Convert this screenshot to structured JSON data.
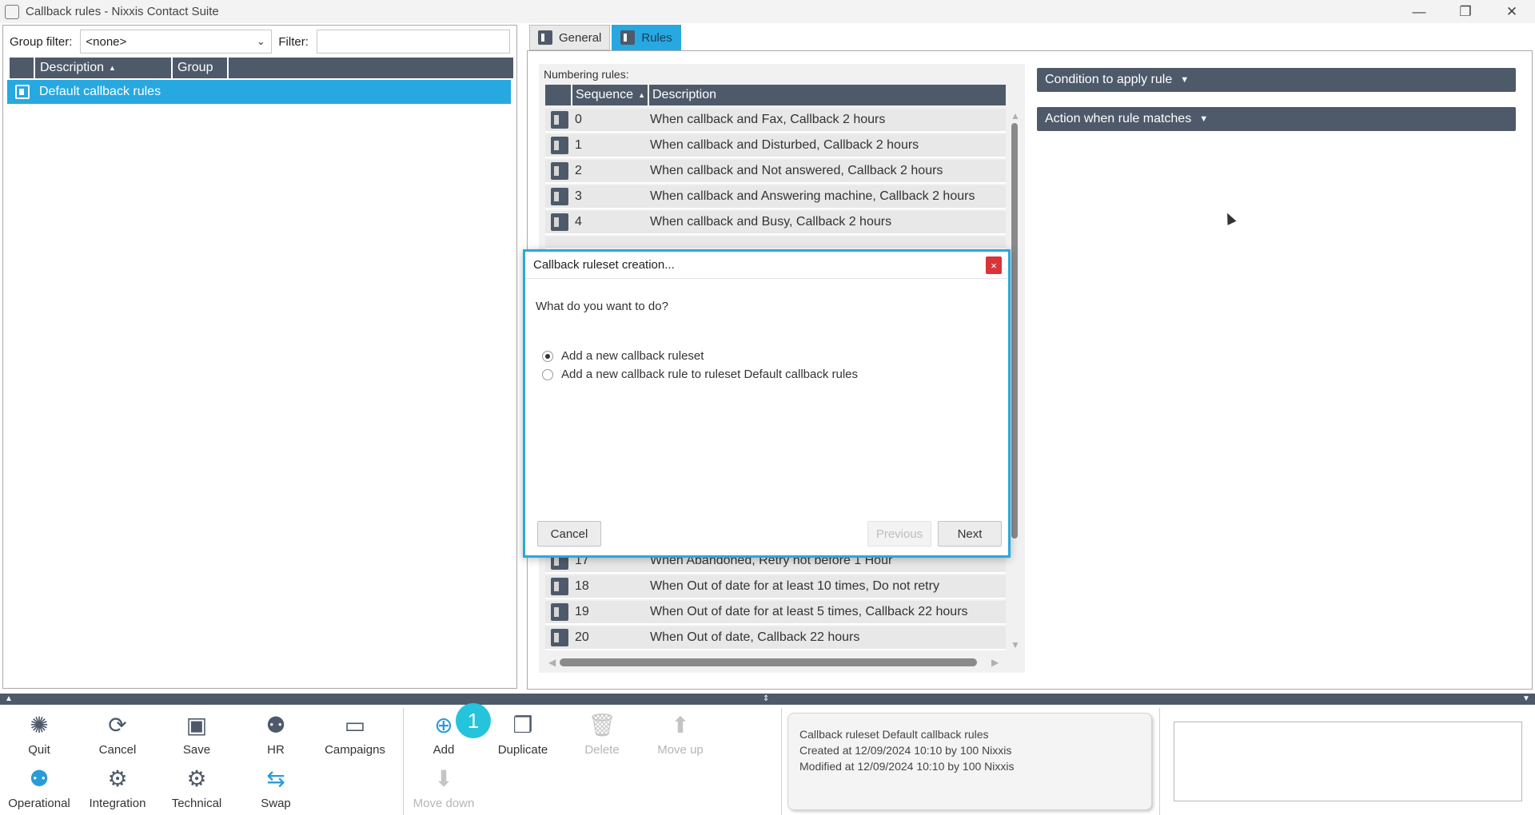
{
  "window": {
    "title": "Callback rules - Nixxis Contact Suite",
    "controls": [
      "—",
      "❐",
      "✕"
    ]
  },
  "left": {
    "group_filter_label": "Group filter:",
    "group_filter_value": "<none>",
    "filter_label": "Filter:",
    "filter_value": "",
    "columns": [
      "Description",
      "Group",
      ""
    ],
    "sort_marker": "▲",
    "rows": [
      {
        "description": "Default callback rules",
        "group": ""
      }
    ]
  },
  "tabs": [
    {
      "label": "General",
      "active": false
    },
    {
      "label": "Rules",
      "active": true
    }
  ],
  "rules": {
    "label": "Numbering rules:",
    "columns": [
      "Sequence",
      "Description"
    ],
    "sort_marker": "▲",
    "rows_top": [
      {
        "seq": "0",
        "desc": "When callback and Fax, Callback 2 hours"
      },
      {
        "seq": "1",
        "desc": "When callback and Disturbed, Callback 2 hours"
      },
      {
        "seq": "2",
        "desc": "When callback and Not answered, Callback 2 hours"
      },
      {
        "seq": "3",
        "desc": "When callback and Answering machine, Callback 2 hours"
      },
      {
        "seq": "4",
        "desc": "When callback and Busy, Callback 2 hours"
      }
    ],
    "rows_bottom": [
      {
        "seq": "17",
        "desc": "When Abandoned, Retry not before 1 Hour"
      },
      {
        "seq": "18",
        "desc": "When Out of date for at least 10 times, Do not retry"
      },
      {
        "seq": "19",
        "desc": "When Out of date for at least 5 times, Callback 22 hours"
      },
      {
        "seq": "20",
        "desc": "When Out of date, Callback 22 hours"
      }
    ]
  },
  "sections": {
    "condition": "Condition to apply rule",
    "action": "Action when rule matches",
    "caret": "▼"
  },
  "dialog": {
    "title": "Callback ruleset creation...",
    "close": "×",
    "question": "What do you want to do?",
    "option1": "Add a new callback ruleset",
    "option2": "Add a new callback rule to ruleset Default callback rules",
    "selected_option": 1,
    "cancel": "Cancel",
    "previous": "Previous",
    "next": "Next"
  },
  "toolbar": {
    "quit": "Quit",
    "cancel": "Cancel",
    "save": "Save",
    "hr": "HR",
    "campaigns": "Campaigns",
    "operational": "Operational",
    "integration": "Integration",
    "technical": "Technical",
    "swap": "Swap",
    "add": "Add",
    "duplicate": "Duplicate",
    "delete": "Delete",
    "move_up": "Move up",
    "move_down": "Move down",
    "badge": "1",
    "icons": {
      "quit": "gear-icon",
      "cancel": "refresh-icon",
      "save": "floppy-icon",
      "hr": "user-gear-icon",
      "campaigns": "monitor-icon",
      "operational": "user-gear-icon",
      "integration": "gear-icon",
      "technical": "gear-icon",
      "swap": "swap-icon",
      "add": "plus-circle-icon",
      "duplicate": "copy-icon",
      "delete": "trash-icon",
      "move_up": "arrow-up-icon",
      "move_down": "arrow-down-icon"
    }
  },
  "info": {
    "line1": "Callback ruleset Default callback rules",
    "line2": "Created at 12/09/2024 10:10 by 100 Nixxis",
    "line3": "Modified at 12/09/2024 10:10 by 100 Nixxis"
  },
  "colors": {
    "accent": "#28a8e0",
    "header": "#4e5a6a",
    "badge": "#25c3dc",
    "close": "#d9343a"
  }
}
